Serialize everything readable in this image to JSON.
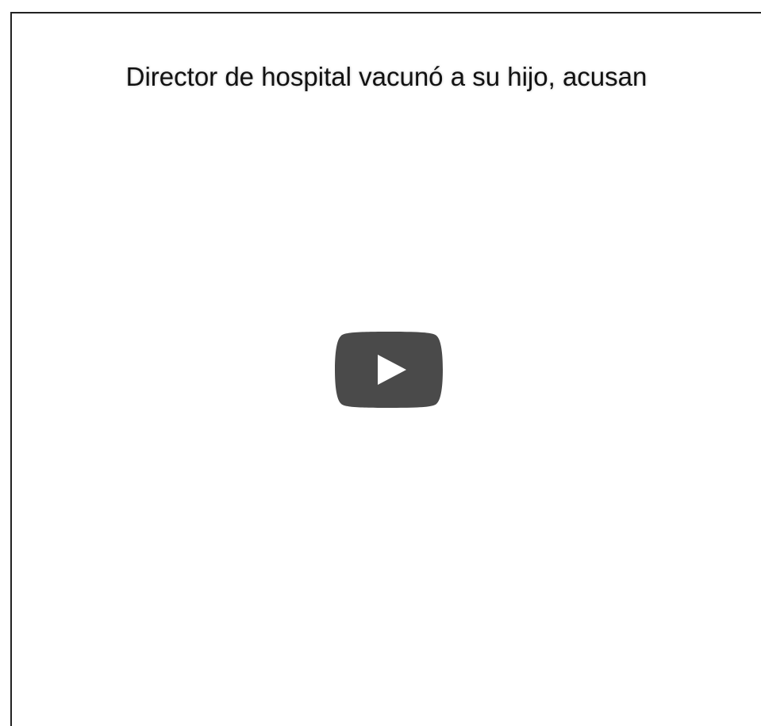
{
  "video": {
    "title": "Director de hospital vacunó a su hijo, acusan",
    "play_icon": "play-icon"
  },
  "colors": {
    "frame_border": "#222222",
    "title_text": "#111111",
    "play_button_bg": "#4a4a4a",
    "play_triangle": "#ffffff"
  }
}
